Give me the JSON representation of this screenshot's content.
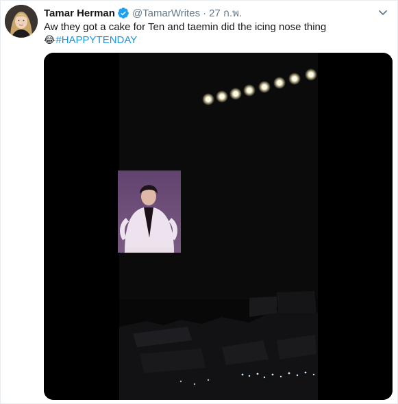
{
  "tweet": {
    "author_name": "Tamar Herman",
    "verified": true,
    "handle": "@TamarWrites",
    "separator": "·",
    "timestamp": "27 ก.พ.",
    "text": "Aw they got a cake for Ten and taemin did the icing nose thing",
    "emoji": "😂",
    "hashtag": "#HAPPYTENDAY"
  },
  "icons": {
    "verified": "verified-badge-icon",
    "menu": "chevron-down-icon"
  },
  "colors": {
    "name": "#14171a",
    "secondary": "#657786",
    "link": "#1b95e0",
    "verified": "#1da1f2",
    "media_bg": "#000000"
  }
}
